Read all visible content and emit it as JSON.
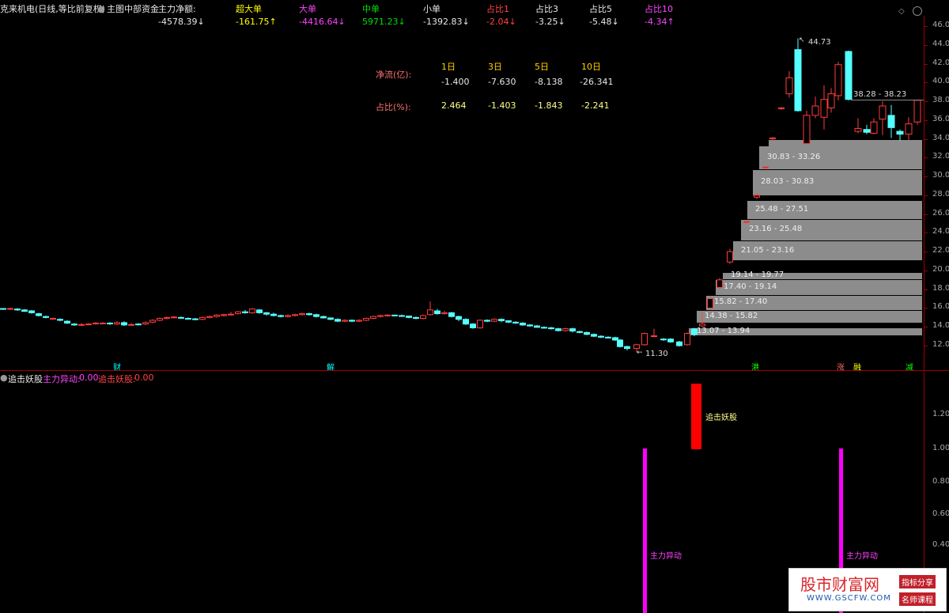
{
  "header": {
    "title": "克来机电(日线,等比前复权)",
    "indicator_name": "主图中部资金",
    "items": [
      {
        "label": "主力净额:",
        "value": "-4578.39",
        "arrow": "↓",
        "color": "#e8e8e8",
        "vcolor": "#e8e8e8"
      },
      {
        "label": "超大单",
        "value": "-161.75",
        "arrow": "↑",
        "color": "#ffff00",
        "vcolor": "#ffff00"
      },
      {
        "label": "大单",
        "value": "-4416.64",
        "arrow": "↓",
        "color": "#ff44ff",
        "vcolor": "#ff44ff"
      },
      {
        "label": "中单",
        "value": "5971.23",
        "arrow": "↓",
        "color": "#00e000",
        "vcolor": "#00e000"
      },
      {
        "label": "小单",
        "value": "-1392.83",
        "arrow": "↓",
        "color": "#e8e8e8",
        "vcolor": "#e8e8e8"
      },
      {
        "label": "占比1",
        "value": "-2.04",
        "arrow": "↓",
        "color": "#ff4444",
        "vcolor": "#ff4444"
      },
      {
        "label": "占比3",
        "value": "-3.25",
        "arrow": "↓",
        "color": "#e8e8e8",
        "vcolor": "#e8e8e8"
      },
      {
        "label": "占比5",
        "value": "-5.48",
        "arrow": "↓",
        "color": "#e8e8e8",
        "vcolor": "#e8e8e8"
      },
      {
        "label": "占比10",
        "value": "-4.34",
        "arrow": "↑",
        "color": "#ff44ff",
        "vcolor": "#ff44ff"
      }
    ]
  },
  "flow_table": {
    "periods": [
      "1日",
      "3日",
      "5日",
      "10日"
    ],
    "net_label": "净流(亿):",
    "net_values": [
      "-1.400",
      "-7.630",
      "-8.138",
      "-26.341"
    ],
    "ratio_label": "占比(%):",
    "ratio_values": [
      "2.464",
      "-1.403",
      "-1.843",
      "-2.241"
    ]
  },
  "price_axis": [
    "46.00",
    "44.00",
    "42.00",
    "40.00",
    "38.00",
    "36.00",
    "34.00",
    "32.00",
    "30.00",
    "28.00",
    "26.00",
    "24.00",
    "22.00",
    "20.00",
    "18.00",
    "16.00",
    "14.00",
    "12.00"
  ],
  "chip_bands": [
    {
      "range": "",
      "low": 34,
      "high": 32,
      "fill": "#8c8c8c"
    },
    {
      "range": "30.83 - 33.26",
      "low": 30.8,
      "high": 33.3
    },
    {
      "range": "28.03 - 30.83",
      "low": 28.0,
      "high": 30.8
    },
    {
      "range": "25.48 - 27.51",
      "low": 25.5,
      "high": 27.5
    },
    {
      "range": "23.16 - 25.48",
      "low": 23.2,
      "high": 25.5
    },
    {
      "range": "21.05 - 23.16",
      "low": 21.05,
      "high": 23.16
    },
    {
      "range": "19.14 - 19.77",
      "low": 19.1,
      "high": 19.8
    },
    {
      "range": "17.40 - 19.14",
      "low": 17.4,
      "high": 19.1
    },
    {
      "range": "15.82 - 17.40",
      "low": 15.8,
      "high": 17.4
    },
    {
      "range": "14.38 - 15.82",
      "low": 14.4,
      "high": 15.8
    },
    {
      "range": "13.07 - 13.94",
      "low": 13.1,
      "high": 13.9
    }
  ],
  "price_labels": {
    "high": "44.73",
    "low": "11.30",
    "range_top": "38.28 - 38.23"
  },
  "event_markers": [
    {
      "text": "财",
      "color": "#00ffff"
    },
    {
      "text": "解",
      "color": "#00ffff"
    },
    {
      "text": "港",
      "color": "#00ff00"
    },
    {
      "text": "涨",
      "color": "#ff6666"
    },
    {
      "text": "融",
      "color": "#ffff00"
    },
    {
      "text": "减",
      "color": "#00ff00"
    }
  ],
  "sub_panel": {
    "name": "追击妖股",
    "items": [
      {
        "label": "主力异动:",
        "value": "0.00",
        "color": "#ff44ff"
      },
      {
        "label": "追击妖股:",
        "value": "0.00",
        "color": "#ff4444"
      }
    ],
    "axis": [
      "1.20",
      "1.00",
      "0.80",
      "0.60",
      "0.40"
    ],
    "signal_labels": [
      "追击妖股",
      "主力异动",
      "主力异动"
    ]
  },
  "watermark": {
    "brand": "股市财富网",
    "url": "WWW.GSCFW.COM",
    "tag1": "指标分享",
    "tag2": "名师课程"
  }
}
